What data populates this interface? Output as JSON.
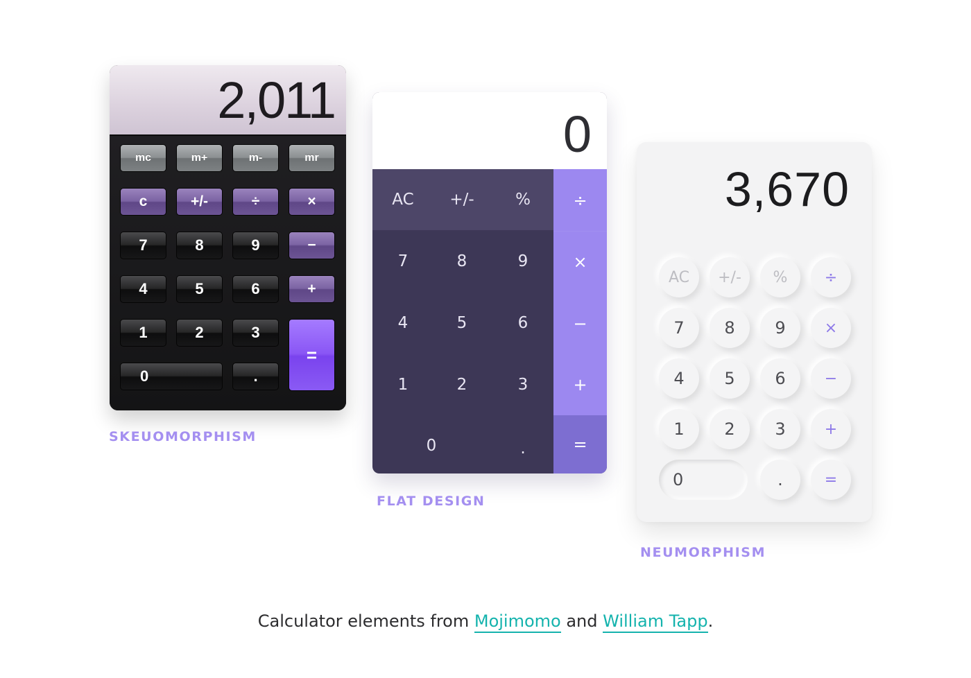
{
  "skeuomorphism": {
    "label": "SKEUOMORPHISM",
    "display": "2,011",
    "keys": {
      "mc": "mc",
      "mplus": "m+",
      "mminus": "m-",
      "mr": "mr",
      "c": "c",
      "sign": "+/-",
      "divide": "÷",
      "multiply": "×",
      "seven": "7",
      "eight": "8",
      "nine": "9",
      "minus": "−",
      "four": "4",
      "five": "5",
      "six": "6",
      "plus": "+",
      "one": "1",
      "two": "2",
      "three": "3",
      "equals": "=",
      "zero": "0",
      "decimal": "."
    }
  },
  "flat_design": {
    "label": "FLAT DESIGN",
    "display": "0",
    "keys": {
      "ac": "AC",
      "sign": "+/-",
      "percent": "%",
      "divide": "÷",
      "seven": "7",
      "eight": "8",
      "nine": "9",
      "multiply": "×",
      "four": "4",
      "five": "5",
      "six": "6",
      "minus": "−",
      "one": "1",
      "two": "2",
      "three": "3",
      "plus": "+",
      "zero": "0",
      "decimal": ".",
      "equals": "="
    }
  },
  "neumorphism": {
    "label": "NEUMORPHISM",
    "display": "3,670",
    "keys": {
      "ac": "AC",
      "sign": "+/-",
      "percent": "%",
      "divide": "÷",
      "seven": "7",
      "eight": "8",
      "nine": "9",
      "multiply": "×",
      "four": "4",
      "five": "5",
      "six": "6",
      "minus": "−",
      "one": "1",
      "two": "2",
      "three": "3",
      "plus": "+",
      "zero": "0",
      "decimal": ".",
      "equals": "="
    }
  },
  "caption": {
    "prefix": "Calculator elements from ",
    "link1": "Mojimomo",
    "middle": " and ",
    "link2": "William Tapp",
    "suffix": "."
  },
  "colors": {
    "label_purple": "#a48ff0",
    "link_teal": "#14b3ad",
    "flat_body": "#3d3756",
    "flat_accent": "#9c88f0",
    "neu_accent": "#8d79e8"
  }
}
